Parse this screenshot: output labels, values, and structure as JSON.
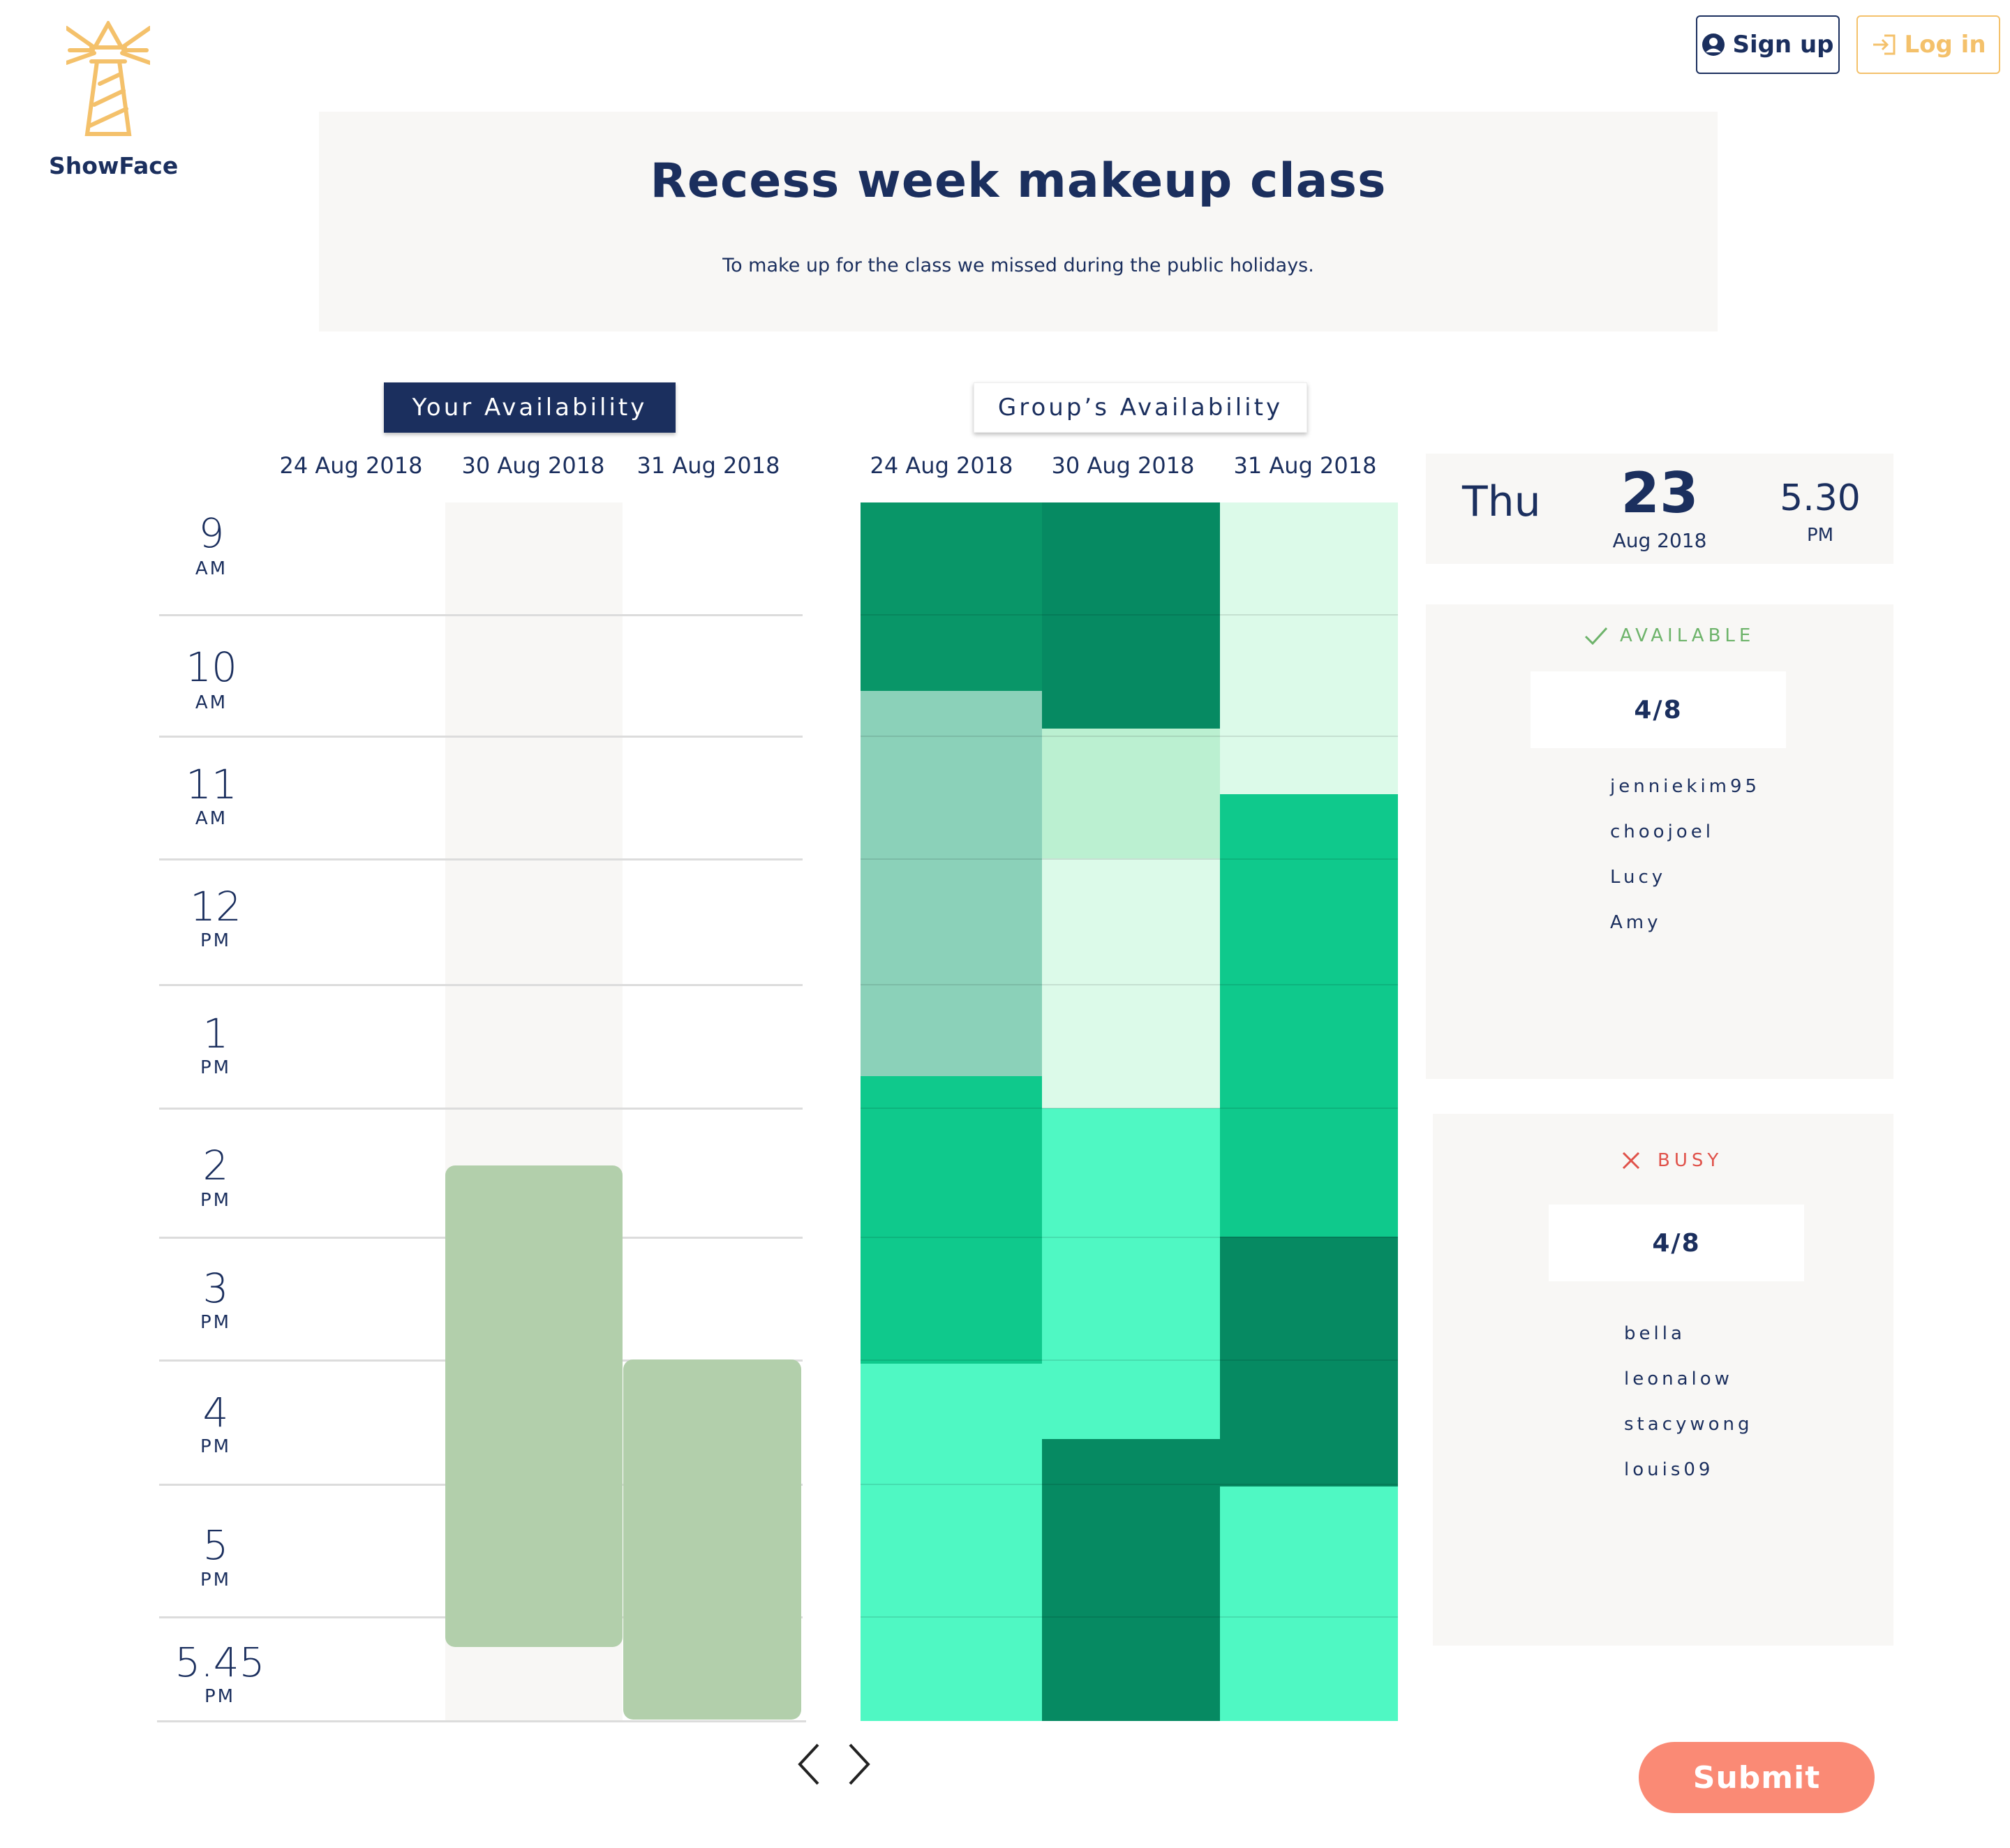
{
  "brand": {
    "name": "ShowFace"
  },
  "header": {
    "signup_label": "Sign up",
    "login_label": "Log in"
  },
  "event": {
    "title": "Recess week makeup class",
    "description": "To make up for the class we missed during the public holidays."
  },
  "tabs": {
    "your": "Your Availability",
    "group": "Group’s Availability"
  },
  "dates": [
    "24 Aug 2018",
    "30 Aug 2018",
    "31 Aug 2018"
  ],
  "times": [
    {
      "num": "9",
      "ampm": "AM"
    },
    {
      "num": "10",
      "ampm": "AM"
    },
    {
      "num": "11",
      "ampm": "AM"
    },
    {
      "num": "12",
      "ampm": "PM"
    },
    {
      "num": "1",
      "ampm": "PM"
    },
    {
      "num": "2",
      "ampm": "PM"
    },
    {
      "num": "3",
      "ampm": "PM"
    },
    {
      "num": "4",
      "ampm": "PM"
    },
    {
      "num": "5",
      "ampm": "PM"
    },
    {
      "num": "5.45",
      "ampm": "PM"
    }
  ],
  "selected": {
    "weekday": "Thu",
    "day": "23",
    "month_year": "Aug 2018",
    "time": "5.30",
    "ampm": "PM"
  },
  "available": {
    "label": "AVAILABLE",
    "count": "4/8",
    "names": [
      "jenniekim95",
      "choojoel",
      "Lucy",
      "Amy"
    ]
  },
  "busy": {
    "label": "BUSY",
    "count": "4/8",
    "names": [
      "bella",
      "leonalow",
      "stacywong",
      "louis09"
    ]
  },
  "submit_label": "Submit",
  "colors": {
    "primary": "#1b2f5e",
    "accent_gold": "#f4c16b",
    "submit": "#fa8a75",
    "your_availability": "#b2cfab",
    "available_green": "#6db36a",
    "busy_red": "#e0524a",
    "heat_dark": "#068a62",
    "heat_mid": "#099668",
    "heat_bright": "#0fc98c",
    "heat_aqua": "#4ff8c3",
    "heat_sage": "#8bd1b9",
    "heat_mint": "#bbf0d1",
    "heat_pale": "#dcfae9"
  }
}
